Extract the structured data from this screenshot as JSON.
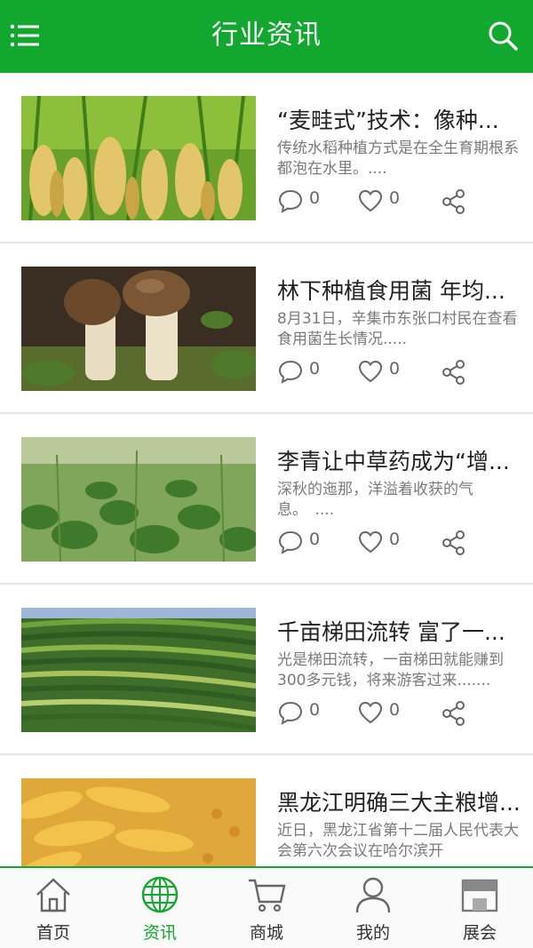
{
  "header": {
    "title": "行业资讯",
    "menu_icon": "menu-icon",
    "search_icon": "search-icon",
    "color": "#12a72e"
  },
  "articles": [
    {
      "title": "“麦畦式”技术：像种...",
      "summary": "传统水稻种植方式是在全生育期根系都泡在水里。....",
      "comments": "0",
      "likes": "0",
      "image": "rice-ears"
    },
    {
      "title": "林下种植食用菌 年均...",
      "summary": "8月31日，辛集市东张口村民在查看食用菌生长情况.....",
      "comments": "0",
      "likes": "0",
      "image": "mushrooms"
    },
    {
      "title": "李青让中草药成为“增...",
      "summary": "深秋的迤那，洋溢着收获的气息。　....",
      "comments": "0",
      "likes": "0",
      "image": "herb-field"
    },
    {
      "title": "千亩梯田流转 富了一...",
      "summary": "光是梯田流转，一亩梯田就能赚到300多元钱，将来游客过来.......",
      "comments": "0",
      "likes": "0",
      "image": "terraced-fields"
    },
    {
      "title": "黑龙江明确三大主粮增...",
      "summary": "近日，黑龙江省第十二届人民代表大会第六次会议在哈尔滨开",
      "comments": "0",
      "likes": "0",
      "image": "corn-harvest"
    }
  ],
  "tabbar": {
    "active_color": "#12a72e",
    "tabs": [
      {
        "label": "首页",
        "icon": "home-icon"
      },
      {
        "label": "资讯",
        "icon": "globe-icon"
      },
      {
        "label": "商城",
        "icon": "cart-icon"
      },
      {
        "label": "我的",
        "icon": "user-icon"
      },
      {
        "label": "展会",
        "icon": "store-icon"
      }
    ]
  }
}
